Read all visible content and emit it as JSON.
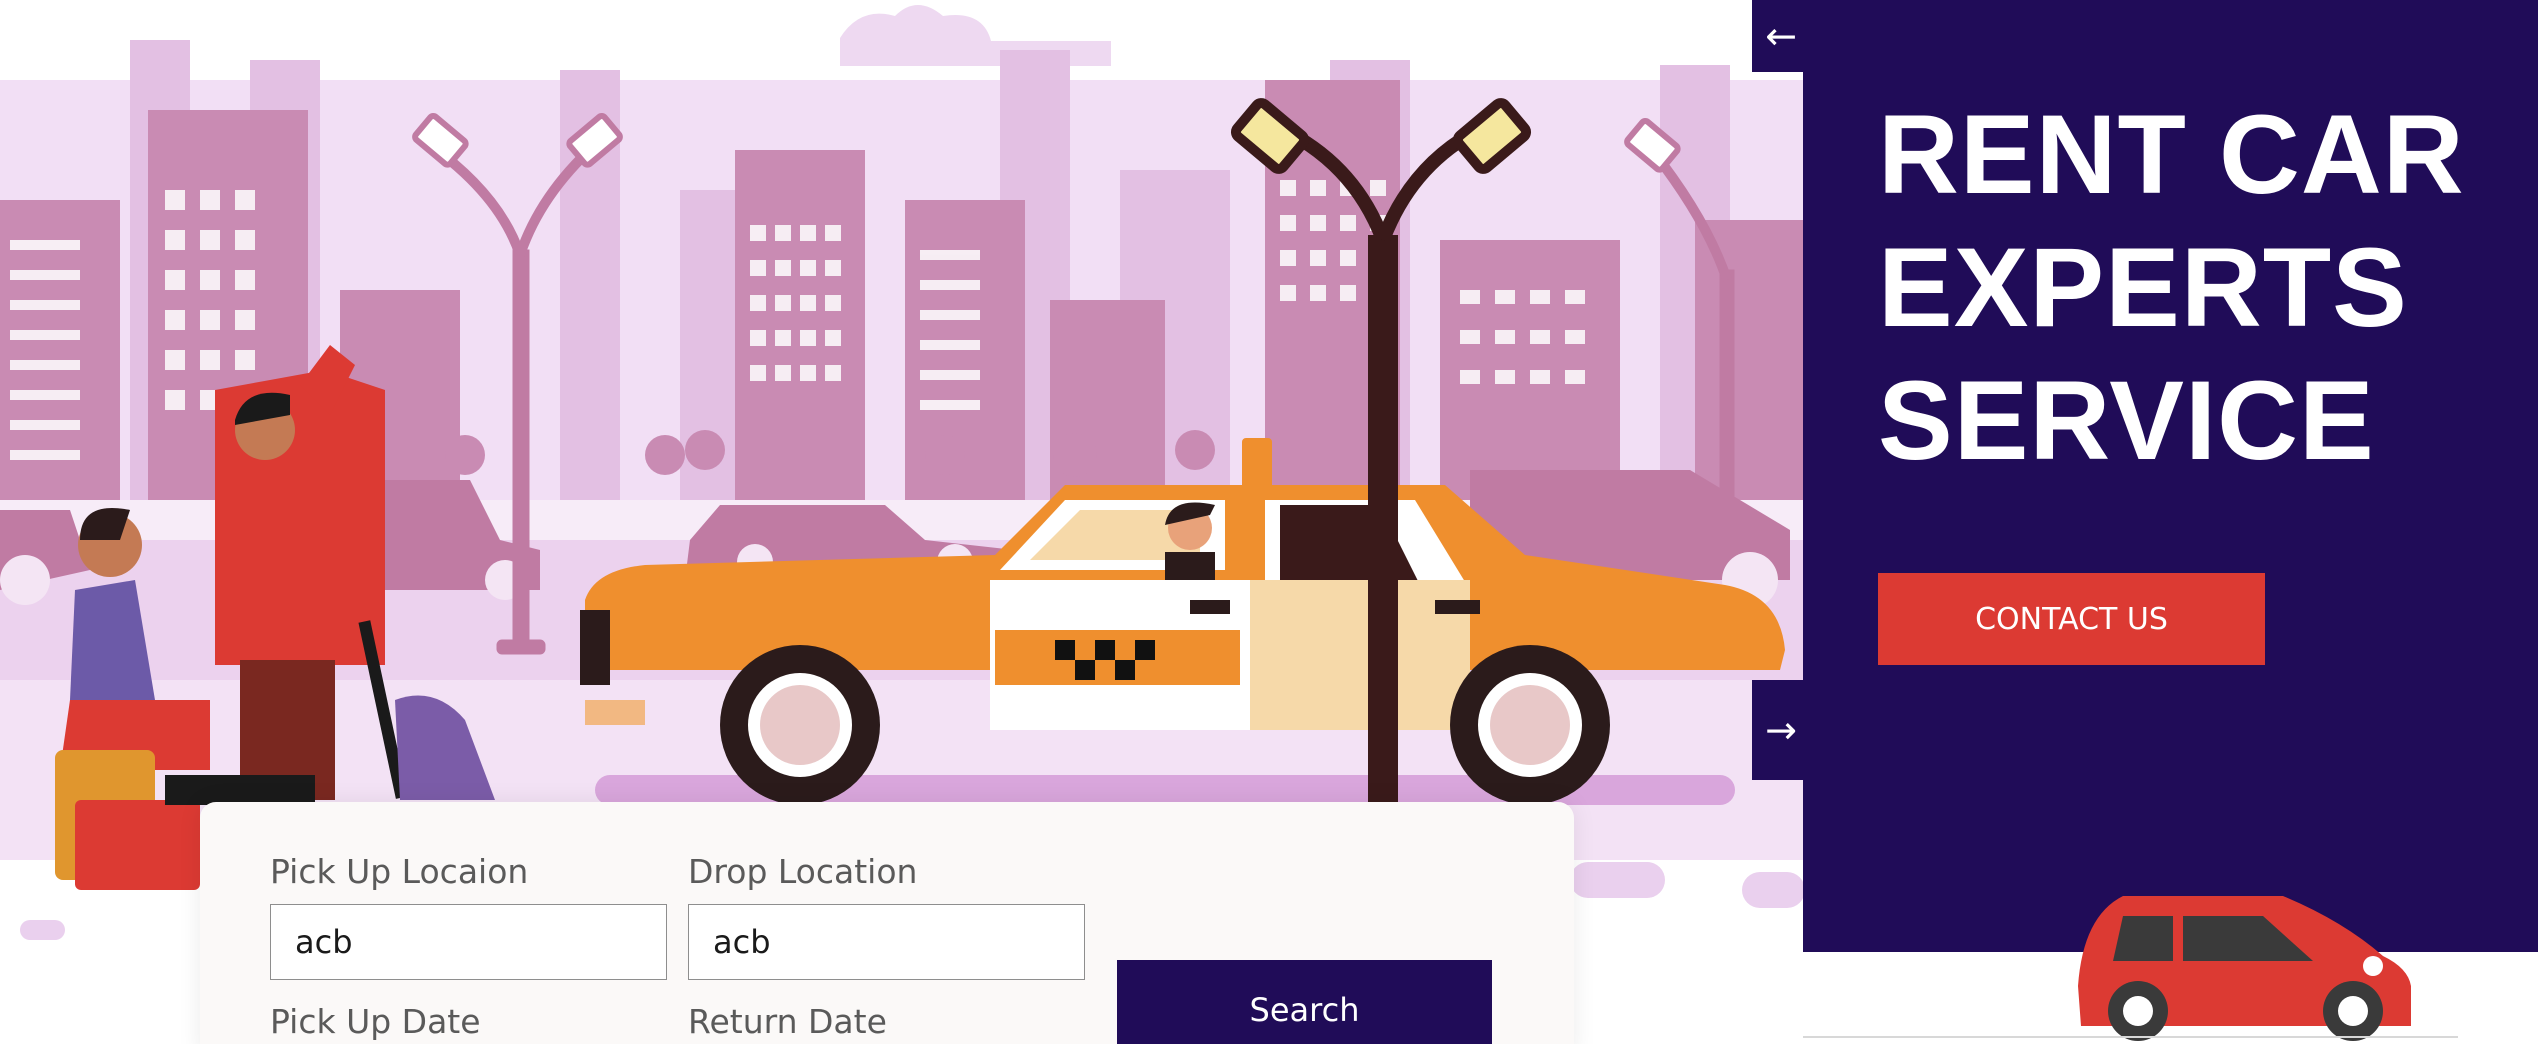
{
  "navigation": {
    "prev_arrow": "←",
    "next_arrow": "→"
  },
  "hero": {
    "title": "RENT CAR\nEXPERTS\nSERVICE",
    "contact_label": "CONTACT US"
  },
  "booking": {
    "pickup_location": {
      "label": "Pick Up Locaion",
      "value": "acb"
    },
    "drop_location": {
      "label": "Drop Location",
      "value": "acb"
    },
    "pickup_date": {
      "label": "Pick Up Date"
    },
    "return_date": {
      "label": "Return Date"
    },
    "search_label": "Search"
  },
  "colors": {
    "panel": "#200c58",
    "accent": "#dc3a33",
    "taxi": "#ef8f2e",
    "sky": "#f5e8f8"
  },
  "icons": [
    "arrow-left-icon",
    "arrow-right-icon"
  ]
}
